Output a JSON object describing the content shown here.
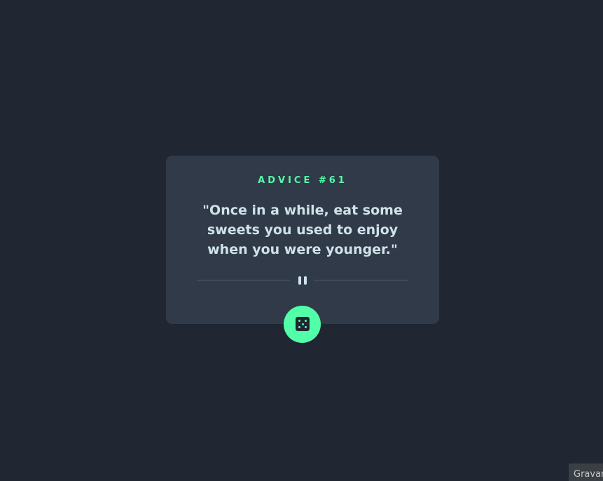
{
  "card": {
    "title": "ADVICE #61",
    "quote": "\"Once in a while, eat some sweets you used to enjoy when you were younger.\""
  },
  "icons": {
    "divider": "pause-icon",
    "button": "dice-icon"
  },
  "corner_tab": {
    "label": "Gravar"
  },
  "colors": {
    "background": "#202632",
    "card": "#313a48",
    "accent": "#52ffa8",
    "text": "#cee3e9",
    "divider": "#4f5d74"
  }
}
